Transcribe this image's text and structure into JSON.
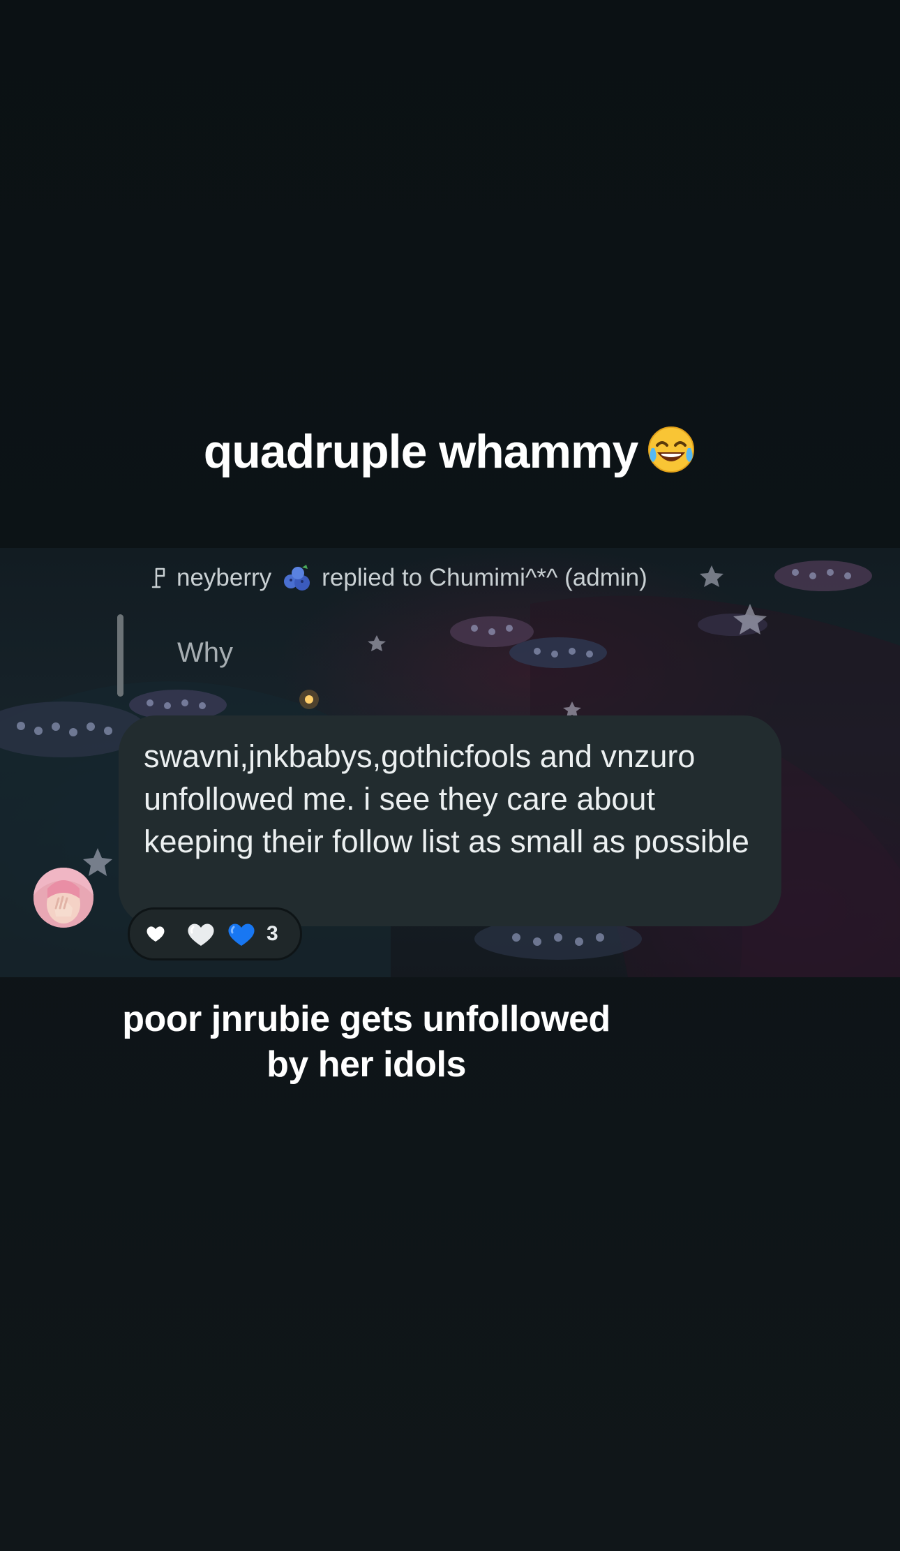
{
  "captions": {
    "top": "quadruple whammy",
    "top_emoji": "face-with-tears-of-joy-icon",
    "bottom_line1": "poor jnrubie gets unfollowed",
    "bottom_line2": "by her idols"
  },
  "post": {
    "reply_icon": "reply-arrow-icon",
    "author": "neyberry",
    "author_emoji": "blueberries-icon",
    "reply_text": "replied to Chumimi^*^ (admin)",
    "quoted_message": "Why",
    "message": "swavni,jnkbabys,gothicfools and vnzuro unfollowed me. i see they care about keeping their follow list as small as possible",
    "avatar": "avatar-pink-hair"
  },
  "reactions": {
    "icons": [
      "white-heart-icon",
      "white-heart-icon",
      "blue-heart-icon"
    ],
    "count": "3"
  },
  "colors": {
    "background": "#0d1417",
    "bubble": "#222c2f",
    "message_text": "#ecf0f1",
    "secondary_text": "#c9d0d3",
    "blue_heart": "#1877f2"
  }
}
